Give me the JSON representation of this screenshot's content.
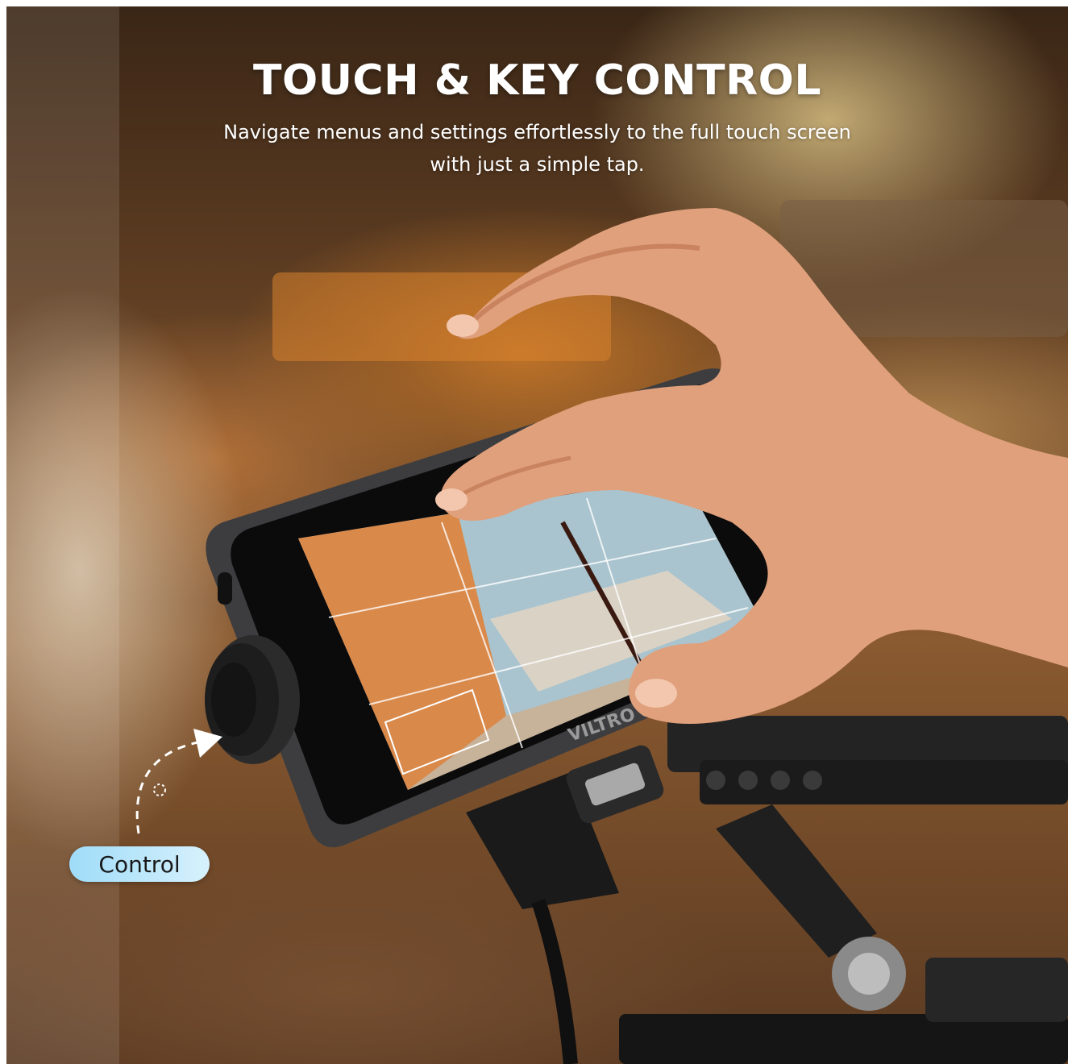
{
  "headline": "TOUCH & KEY CONTROL",
  "subheadline": [
    "Navigate menus and settings effortlessly to the full touch screen",
    "with just a simple tap."
  ],
  "callout": {
    "label": "Control",
    "color": "#b7e6fb"
  },
  "device": {
    "brand_text": "VILTRO"
  }
}
